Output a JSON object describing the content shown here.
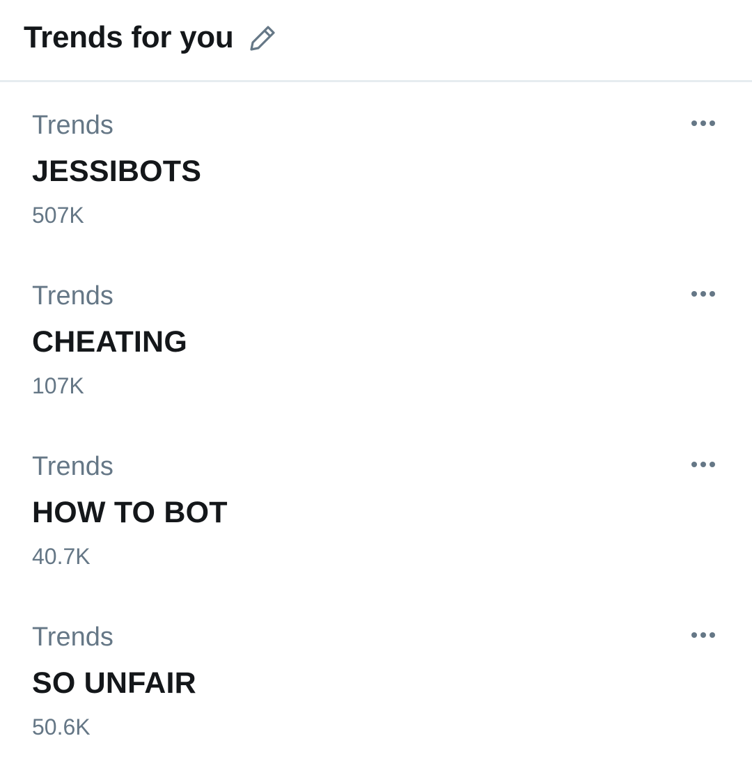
{
  "header": {
    "title": "Trends for you"
  },
  "icons": {
    "edit": "pencil-icon",
    "more": "more-horizontal-icon"
  },
  "colors": {
    "primary_text": "#14171a",
    "secondary_text": "#657786",
    "divider": "#e6ecf0",
    "background": "#ffffff"
  },
  "trends": [
    {
      "category": "Trends",
      "name": "JESSIBOTS",
      "count": "507K"
    },
    {
      "category": "Trends",
      "name": "CHEATING",
      "count": "107K"
    },
    {
      "category": "Trends",
      "name": "HOW TO BOT",
      "count": "40.7K"
    },
    {
      "category": "Trends",
      "name": "SO UNFAIR",
      "count": "50.6K"
    }
  ]
}
